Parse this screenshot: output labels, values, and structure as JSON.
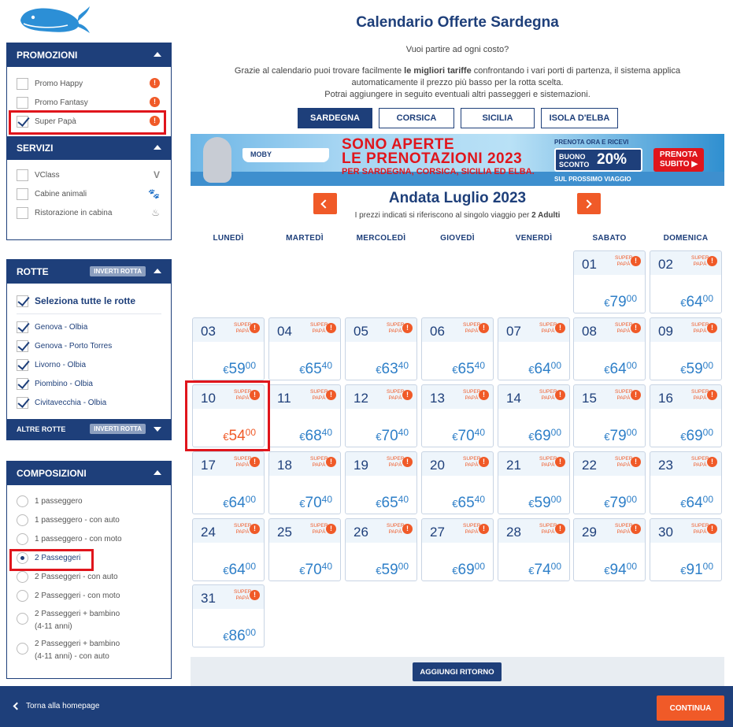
{
  "header": {
    "title": "Calendario Offerte Sardegna",
    "tagline": "Vuoi partire ad ogni costo?",
    "intro_a": "Grazie al calendario puoi trovare facilmente ",
    "intro_bold": "le migliori tariffe",
    "intro_b": " confrontando i vari porti di partenza, il sistema applica",
    "intro_line2": "automaticamente il prezzo più basso per la rotta scelta.",
    "intro_line3": "Potrai aggiungere in seguito eventuali altri passeggeri e sistemazioni."
  },
  "destinations": [
    {
      "label": "SARDEGNA",
      "active": true
    },
    {
      "label": "CORSICA",
      "active": false
    },
    {
      "label": "SICILIA",
      "active": false
    },
    {
      "label": "ISOLA D'ELBA",
      "active": false
    }
  ],
  "banner": {
    "line1": "SONO APERTE",
    "line2": "LE PRENOTAZIONI 2023",
    "line3": "PER SARDEGNA, CORSICA, SICILIA ED ELBA.",
    "offer_top": "PRENOTA ORA E RICEVI",
    "badge_label1": "BUONO",
    "badge_label2": "SCONTO",
    "badge_pct": "20%",
    "offer_bottom": "SUL PROSSIMO VIAGGIO",
    "cta1": "PRENOTA",
    "cta2": "SUBITO ▶"
  },
  "sidebar": {
    "promotions": {
      "title": "PROMOZIONI",
      "items": [
        {
          "label": "Promo Happy",
          "checked": false
        },
        {
          "label": "Promo Fantasy",
          "checked": false
        },
        {
          "label": "Super Papà",
          "checked": true
        }
      ]
    },
    "services": {
      "title": "SERVIZI",
      "items": [
        {
          "label": "VClass",
          "icon": "vclass-icon",
          "glyph": "V"
        },
        {
          "label": "Cabine animali",
          "icon": "paw-icon",
          "glyph": "🐾"
        },
        {
          "label": "Ristorazione in cabina",
          "icon": "food-icon",
          "glyph": "♨"
        }
      ]
    },
    "routes": {
      "title": "ROTTE",
      "invert_label": "INVERTI ROTTA",
      "select_all": "Seleziona tutte le rotte",
      "items": [
        {
          "label": "Genova - Olbia"
        },
        {
          "label": "Genova - Porto Torres"
        },
        {
          "label": "Livorno - Olbia"
        },
        {
          "label": "Piombino - Olbia"
        },
        {
          "label": "Civitavecchia - Olbia"
        }
      ],
      "other_title": "ALTRE ROTTE",
      "other_invert_label": "INVERTI ROTTA"
    },
    "compositions": {
      "title": "COMPOSIZIONI",
      "items": [
        {
          "line1": "1 passeggero",
          "line2": "",
          "selected": false
        },
        {
          "line1": "1 passeggero - con auto",
          "line2": "",
          "selected": false
        },
        {
          "line1": "1 passeggero - con moto",
          "line2": "",
          "selected": false
        },
        {
          "line1": "2 Passeggeri",
          "line2": "",
          "selected": true
        },
        {
          "line1": "2 Passeggeri - con auto",
          "line2": "",
          "selected": false
        },
        {
          "line1": "2 Passeggeri - con moto",
          "line2": "",
          "selected": false
        },
        {
          "line1": "2 Passeggeri + bambino",
          "line2": "(4-11 anni)",
          "selected": false
        },
        {
          "line1": "2 Passeggeri + bambino",
          "line2": "(4-11 anni) - con auto",
          "selected": false
        }
      ]
    }
  },
  "calendar": {
    "month_title": "Andata Luglio 2023",
    "note_a": "I prezzi indicati si riferiscono al singolo viaggio per ",
    "note_bold": "2 Adulti",
    "weekdays": [
      "LUNEDÌ",
      "MARTEDÌ",
      "MERCOLEDÌ",
      "GIOVEDÌ",
      "VENERDÌ",
      "SABATO",
      "DOMENICA"
    ],
    "promo_line1": "SUPER",
    "promo_line2": "PAPÀ",
    "currency": "€",
    "best_day": "10",
    "days": [
      {
        "day": "01",
        "int": "79",
        "dec": "00",
        "col": 5,
        "row": 0
      },
      {
        "day": "02",
        "int": "64",
        "dec": "00",
        "col": 6,
        "row": 0
      },
      {
        "day": "03",
        "int": "59",
        "dec": "00",
        "col": 0,
        "row": 1
      },
      {
        "day": "04",
        "int": "65",
        "dec": "40",
        "col": 1,
        "row": 1
      },
      {
        "day": "05",
        "int": "63",
        "dec": "40",
        "col": 2,
        "row": 1
      },
      {
        "day": "06",
        "int": "65",
        "dec": "40",
        "col": 3,
        "row": 1
      },
      {
        "day": "07",
        "int": "64",
        "dec": "00",
        "col": 4,
        "row": 1
      },
      {
        "day": "08",
        "int": "64",
        "dec": "00",
        "col": 5,
        "row": 1
      },
      {
        "day": "09",
        "int": "59",
        "dec": "00",
        "col": 6,
        "row": 1
      },
      {
        "day": "10",
        "int": "54",
        "dec": "00",
        "col": 0,
        "row": 2
      },
      {
        "day": "11",
        "int": "68",
        "dec": "40",
        "col": 1,
        "row": 2
      },
      {
        "day": "12",
        "int": "70",
        "dec": "40",
        "col": 2,
        "row": 2
      },
      {
        "day": "13",
        "int": "70",
        "dec": "40",
        "col": 3,
        "row": 2
      },
      {
        "day": "14",
        "int": "69",
        "dec": "00",
        "col": 4,
        "row": 2
      },
      {
        "day": "15",
        "int": "79",
        "dec": "00",
        "col": 5,
        "row": 2
      },
      {
        "day": "16",
        "int": "69",
        "dec": "00",
        "col": 6,
        "row": 2
      },
      {
        "day": "17",
        "int": "64",
        "dec": "00",
        "col": 0,
        "row": 3
      },
      {
        "day": "18",
        "int": "70",
        "dec": "40",
        "col": 1,
        "row": 3
      },
      {
        "day": "19",
        "int": "65",
        "dec": "40",
        "col": 2,
        "row": 3
      },
      {
        "day": "20",
        "int": "65",
        "dec": "40",
        "col": 3,
        "row": 3
      },
      {
        "day": "21",
        "int": "59",
        "dec": "00",
        "col": 4,
        "row": 3
      },
      {
        "day": "22",
        "int": "79",
        "dec": "00",
        "col": 5,
        "row": 3
      },
      {
        "day": "23",
        "int": "64",
        "dec": "00",
        "col": 6,
        "row": 3
      },
      {
        "day": "24",
        "int": "64",
        "dec": "00",
        "col": 0,
        "row": 4
      },
      {
        "day": "25",
        "int": "70",
        "dec": "40",
        "col": 1,
        "row": 4
      },
      {
        "day": "26",
        "int": "59",
        "dec": "00",
        "col": 2,
        "row": 4
      },
      {
        "day": "27",
        "int": "69",
        "dec": "00",
        "col": 3,
        "row": 4
      },
      {
        "day": "28",
        "int": "74",
        "dec": "00",
        "col": 4,
        "row": 4
      },
      {
        "day": "29",
        "int": "94",
        "dec": "00",
        "col": 5,
        "row": 4
      },
      {
        "day": "30",
        "int": "91",
        "dec": "00",
        "col": 6,
        "row": 4
      },
      {
        "day": "31",
        "int": "86",
        "dec": "00",
        "col": 0,
        "row": 5
      }
    ],
    "add_return": "AGGIUNGI RITORNO"
  },
  "footer": {
    "back_label": "Torna alla homepage",
    "continue_label": "CONTINUA"
  },
  "colors": {
    "primary": "#1e3f7a",
    "accent": "#f05a28",
    "price": "#2e7fc8",
    "highlight": "#e0151c"
  }
}
